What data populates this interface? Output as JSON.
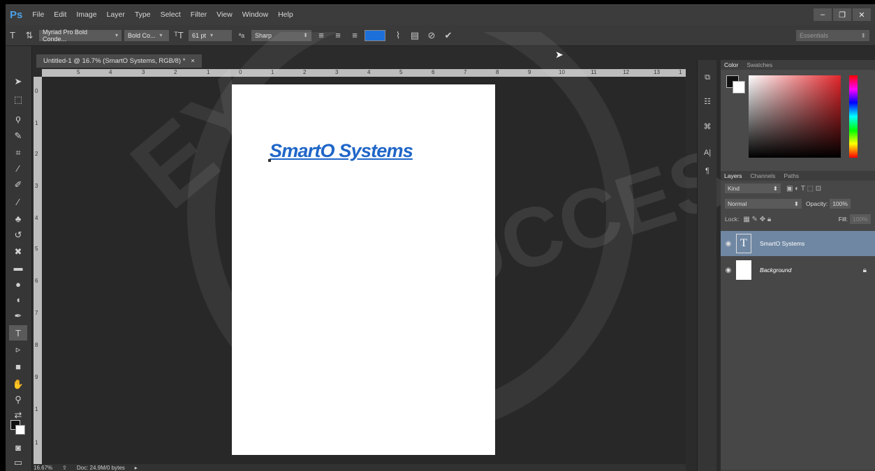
{
  "app": {
    "logo": "Ps",
    "brand_color": "#4aa0e6"
  },
  "menu": [
    "File",
    "Edit",
    "Image",
    "Layer",
    "Type",
    "Select",
    "Filter",
    "View",
    "Window",
    "Help"
  ],
  "window_controls": {
    "minimize": "–",
    "restore": "❐",
    "close": "✕"
  },
  "options_bar": {
    "font_family": "Myriad Pro Bold Conde...",
    "font_style": "Bold Co...",
    "font_size": "61 pt",
    "antialias_icon_label": "ªa",
    "antialias": "Sharp",
    "text_color": "#1d70d9",
    "workspace": "Essentials"
  },
  "document": {
    "tab_title": "Untitled-1 @ 16.7% (SmartO Systems, RGB/8) *",
    "text": "SmartO Systems",
    "text_color": "#1f66c8"
  },
  "ruler": {
    "h_ticks": [
      "5",
      "4",
      "3",
      "2",
      "1",
      "0",
      "1",
      "2",
      "3",
      "4",
      "5",
      "6",
      "7",
      "8",
      "9",
      "10",
      "11",
      "12",
      "13",
      "1"
    ],
    "v_ticks": [
      "0",
      "1",
      "2",
      "3",
      "4",
      "5",
      "6",
      "7",
      "8",
      "9",
      "1",
      "1"
    ]
  },
  "status": {
    "zoom": "16.67%",
    "doc_size": "Doc: 24.9M/0 bytes"
  },
  "color_panel": {
    "tabs": [
      "Color",
      "Swatches"
    ],
    "fg": "#111111",
    "bg": "#ffffff"
  },
  "layers_panel": {
    "tabs": [
      "Layers",
      "Channels",
      "Paths"
    ],
    "filter_kind": "Kind",
    "blend_mode": "Normal",
    "opacity_label": "Opacity:",
    "opacity_value": "100%",
    "lock_label": "Lock:",
    "fill_label": "Fill:",
    "fill_value": "100%",
    "layers": [
      {
        "name": "SmartO Systems",
        "type": "text"
      },
      {
        "name": "Background",
        "type": "image"
      }
    ]
  },
  "watermark": {
    "top": "EY",
    "bottom": "TO SUCCESS"
  }
}
